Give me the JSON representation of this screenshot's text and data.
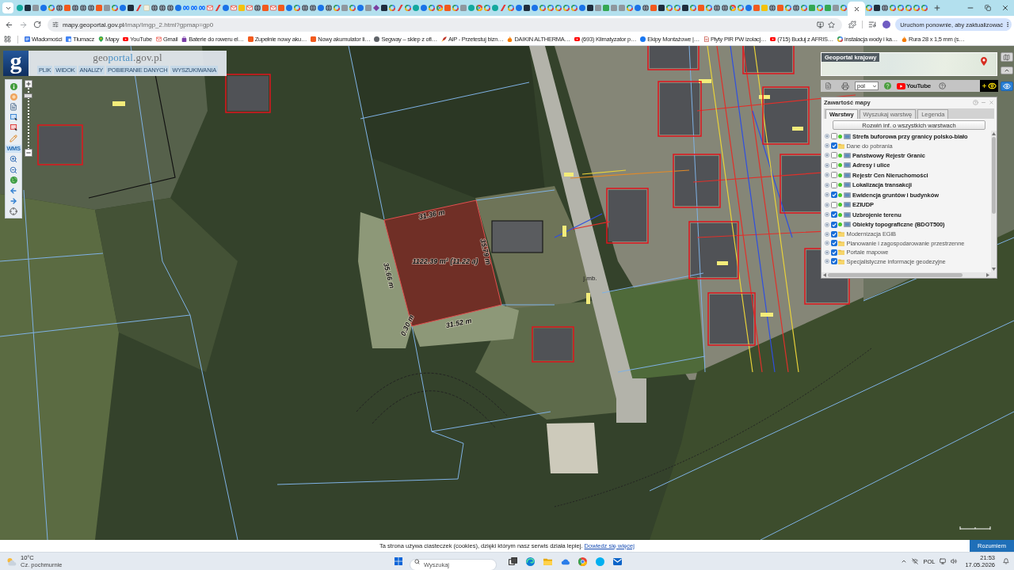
{
  "browser": {
    "tabs": [
      {
        "kind": "teal",
        "selected": false
      },
      {
        "kind": "dark",
        "selected": false
      },
      {
        "kind": "gray",
        "selected": false
      },
      {
        "kind": "blue",
        "selected": false
      },
      {
        "kind": "google",
        "selected": false
      },
      {
        "kind": "globe",
        "selected": false
      },
      {
        "kind": "orange",
        "selected": false
      },
      {
        "kind": "globe",
        "selected": false
      },
      {
        "kind": "globe",
        "selected": false
      },
      {
        "kind": "globe",
        "selected": false
      },
      {
        "kind": "orange",
        "selected": false
      },
      {
        "kind": "gray",
        "selected": false
      },
      {
        "kind": "google",
        "selected": false
      },
      {
        "kind": "blue",
        "selected": false
      },
      {
        "kind": "dark",
        "selected": false
      },
      {
        "kind": "red",
        "selected": false
      },
      {
        "kind": "light",
        "selected": false
      },
      {
        "kind": "globe",
        "selected": false
      },
      {
        "kind": "globe",
        "selected": false
      },
      {
        "kind": "globe",
        "selected": false
      },
      {
        "kind": "blue",
        "selected": false
      },
      {
        "kind": "meta",
        "selected": false
      },
      {
        "kind": "meta",
        "selected": false
      },
      {
        "kind": "meta",
        "selected": false
      },
      {
        "kind": "gmail",
        "selected": false
      },
      {
        "kind": "red",
        "selected": false
      },
      {
        "kind": "blue",
        "selected": false
      },
      {
        "kind": "gmail",
        "selected": false
      },
      {
        "kind": "yellow",
        "selected": false
      },
      {
        "kind": "gmail",
        "selected": false
      },
      {
        "kind": "globe",
        "selected": false
      },
      {
        "kind": "orange",
        "selected": false
      },
      {
        "kind": "gmail",
        "selected": false
      },
      {
        "kind": "orange",
        "selected": false
      },
      {
        "kind": "blue",
        "selected": false
      },
      {
        "kind": "google",
        "selected": false
      },
      {
        "kind": "globe",
        "selected": false
      },
      {
        "kind": "globe",
        "selected": false
      },
      {
        "kind": "blue",
        "selected": false
      },
      {
        "kind": "globe",
        "selected": false
      },
      {
        "kind": "google",
        "selected": false
      },
      {
        "kind": "gray",
        "selected": false
      },
      {
        "kind": "google",
        "selected": false
      },
      {
        "kind": "blue",
        "selected": false
      },
      {
        "kind": "gray",
        "selected": false
      },
      {
        "kind": "purple",
        "selected": false
      },
      {
        "kind": "dark",
        "selected": false
      },
      {
        "kind": "google",
        "selected": false
      },
      {
        "kind": "red",
        "selected": false
      },
      {
        "kind": "google",
        "selected": false
      },
      {
        "kind": "teal",
        "selected": false
      },
      {
        "kind": "blue",
        "selected": false
      },
      {
        "kind": "google",
        "selected": false
      },
      {
        "kind": "multi",
        "selected": false
      },
      {
        "kind": "orange",
        "selected": false
      },
      {
        "kind": "google",
        "selected": false
      },
      {
        "kind": "gray",
        "selected": false
      },
      {
        "kind": "teal",
        "selected": false
      },
      {
        "kind": "multi",
        "selected": false
      },
      {
        "kind": "google",
        "selected": false
      },
      {
        "kind": "teal",
        "selected": false
      },
      {
        "kind": "red",
        "selected": false
      },
      {
        "kind": "google",
        "selected": false
      },
      {
        "kind": "blue",
        "selected": false
      },
      {
        "kind": "dark",
        "selected": false
      },
      {
        "kind": "blue",
        "selected": false
      },
      {
        "kind": "google",
        "selected": false
      },
      {
        "kind": "google",
        "selected": false
      },
      {
        "kind": "google",
        "selected": false
      },
      {
        "kind": "google",
        "selected": false
      },
      {
        "kind": "google",
        "selected": false
      },
      {
        "kind": "blue",
        "selected": false
      },
      {
        "kind": "dark",
        "selected": false
      },
      {
        "kind": "gray",
        "selected": false
      },
      {
        "kind": "green",
        "selected": false
      },
      {
        "kind": "gray",
        "selected": false
      },
      {
        "kind": "gray",
        "selected": false
      },
      {
        "kind": "google",
        "selected": false
      },
      {
        "kind": "blue",
        "selected": false
      },
      {
        "kind": "globe",
        "selected": false
      },
      {
        "kind": "orange",
        "selected": false
      },
      {
        "kind": "dark",
        "selected": false
      },
      {
        "kind": "google",
        "selected": false
      },
      {
        "kind": "google",
        "selected": false
      },
      {
        "kind": "dark",
        "selected": false
      },
      {
        "kind": "google",
        "selected": false
      },
      {
        "kind": "orange",
        "selected": false
      },
      {
        "kind": "google",
        "selected": false
      },
      {
        "kind": "globe",
        "selected": false
      },
      {
        "kind": "globe",
        "selected": false
      },
      {
        "kind": "multi",
        "selected": false
      },
      {
        "kind": "google",
        "selected": false
      },
      {
        "kind": "blue",
        "selected": false
      },
      {
        "kind": "orange",
        "selected": false
      },
      {
        "kind": "yellow",
        "selected": false
      },
      {
        "kind": "globe",
        "selected": false
      },
      {
        "kind": "orange",
        "selected": false
      },
      {
        "kind": "google",
        "selected": false
      },
      {
        "kind": "globe",
        "selected": false
      },
      {
        "kind": "google",
        "selected": false
      },
      {
        "kind": "green",
        "selected": false
      },
      {
        "kind": "google",
        "selected": false
      },
      {
        "kind": "green",
        "selected": false
      },
      {
        "kind": "gray",
        "selected": false
      },
      {
        "kind": "google",
        "selected": false
      },
      {
        "selected": true
      },
      {
        "kind": "google",
        "selected": false
      },
      {
        "kind": "dark",
        "selected": false
      },
      {
        "kind": "globe",
        "selected": false
      },
      {
        "kind": "google",
        "selected": false
      },
      {
        "kind": "google",
        "selected": false
      },
      {
        "kind": "google",
        "selected": false
      },
      {
        "kind": "google",
        "selected": false
      },
      {
        "kind": "google",
        "selected": false
      }
    ],
    "address": {
      "host": "mapy.geoportal.gov.pl",
      "path": "/imap/Imgp_2.html?gpmap=gp0"
    },
    "update_button": "Uruchom ponownie, aby zaktualizować",
    "bookmarks": [
      {
        "kind": "news",
        "label": "Wiadomości"
      },
      {
        "kind": "translate",
        "label": "Tłumacz"
      },
      {
        "kind": "maps",
        "label": "Mapy"
      },
      {
        "kind": "youtube",
        "label": "YouTube"
      },
      {
        "kind": "gmail",
        "label": "Gmail"
      },
      {
        "kind": "shop",
        "label": "Baterie do roweru el…"
      },
      {
        "kind": "orange",
        "label": "Zupełnie nowy aku…"
      },
      {
        "kind": "orange",
        "label": "Nowy akumulator li…"
      },
      {
        "kind": "letter",
        "label": "Segway – sklep z ofi…"
      },
      {
        "kind": "rocket",
        "label": "AiP - Przetestuj bizn…"
      },
      {
        "kind": "flame",
        "label": "DAIKIN ALTHERMA…"
      },
      {
        "kind": "youtube",
        "label": "(693) Klimatyzator p…"
      },
      {
        "kind": "facebook",
        "label": "Ekipy Montażowe |…"
      },
      {
        "kind": "page",
        "label": "Płyty PIR PW izolacj…"
      },
      {
        "kind": "youtube",
        "label": "(715) Buduj z AFRIS…"
      },
      {
        "kind": "google",
        "label": "instalacja wody i ka…"
      },
      {
        "kind": "flame",
        "label": "Rura 28 x 1,5 mm (s…"
      }
    ]
  },
  "geoportal": {
    "logo": {
      "mark": "g",
      "title": [
        {
          "text": "geo",
          "kind": "plain"
        },
        {
          "text": "portal",
          "kind": "accent"
        },
        {
          "text": ".gov.pl",
          "kind": "plain"
        }
      ]
    },
    "menu": [
      "PLIK",
      "WIDOK",
      "ANALIZY",
      "POBIERANIE DANYCH",
      "WYSZUKIWANIA"
    ],
    "tools": [
      {
        "kind": "info"
      },
      {
        "kind": "home"
      },
      {
        "kind": "page"
      },
      {
        "kind": "select"
      },
      {
        "kind": "select_red"
      },
      {
        "kind": "pencil"
      },
      {
        "kind": "wms",
        "label": "WMS"
      },
      {
        "kind": "zoom_in"
      },
      {
        "kind": "zoom_out"
      },
      {
        "kind": "globe"
      },
      {
        "kind": "back"
      },
      {
        "kind": "forward"
      },
      {
        "kind": "target"
      }
    ],
    "zoom": {
      "level": 0.9
    },
    "overview": {
      "title": "Geoportal krajowy"
    },
    "toolbar": {
      "language": "pol",
      "video_logo": "YouTube"
    },
    "contents": {
      "title": "Zawartość mapy",
      "tabs": [
        {
          "label": "Warstwy",
          "selected": true
        },
        {
          "label": "Wyszukaj warstwę",
          "selected": false
        },
        {
          "label": "Legenda",
          "selected": false
        }
      ],
      "expand_all": "Rozwiń inf. o wszystkich warstwach",
      "layers": [
        {
          "kind": "service",
          "name": "Strefa buforowa przy granicy polsko-biało",
          "checked": false
        },
        {
          "kind": "group",
          "name": "Dane do pobrania",
          "checked": true
        },
        {
          "kind": "service",
          "name": "Państwowy Rejestr Granic",
          "checked": false
        },
        {
          "kind": "service",
          "name": "Adresy i ulice",
          "checked": false
        },
        {
          "kind": "service",
          "name": "Rejestr Cen Nieruchomości",
          "checked": false
        },
        {
          "kind": "service",
          "name": "Lokalizacja transakcji",
          "checked": false
        },
        {
          "kind": "service",
          "name": "Ewidencja gruntów i budynków",
          "checked": true
        },
        {
          "kind": "service",
          "name": "EZIUDP",
          "checked": false
        },
        {
          "kind": "service",
          "name": "Uzbrojenie terenu",
          "checked": true
        },
        {
          "kind": "service",
          "name": "Obiekty topograficzne (BDOT500)",
          "checked": true
        },
        {
          "kind": "group",
          "name": "Modernizacja EGiB",
          "checked": true
        },
        {
          "kind": "group",
          "name": "Planowanie i zagospodarowanie przestrzenne",
          "checked": true
        },
        {
          "kind": "group",
          "name": "Portale mapowe",
          "checked": true
        },
        {
          "kind": "group",
          "name": "Specjalistyczne informacje geodezyjne",
          "checked": true
        }
      ]
    }
  },
  "map": {
    "labels": [
      "j.mb."
    ],
    "measurement": {
      "area": "1122.39 m² (11.22 a)",
      "edges": [
        "31.36 m",
        "35.79 m",
        "35.66 m",
        "31.52 m",
        "0.30 m"
      ]
    }
  },
  "cookie_bar": {
    "message": "Ta strona używa ciasteczek (cookies), dzięki którym nasz serwis działa lepiej.",
    "link": "Dowiedz się więcej",
    "button": "Rozumiem"
  },
  "taskbar": {
    "weather": {
      "temperature": "10°C",
      "condition": "Cz. pochmurnie"
    },
    "search": {
      "placeholder": "Wyszukaj"
    },
    "apps": [
      {
        "kind": "taskview"
      },
      {
        "kind": "edge"
      },
      {
        "kind": "explorer"
      },
      {
        "kind": "cloud"
      },
      {
        "kind": "chrome"
      },
      {
        "kind": "skype"
      },
      {
        "kind": "outlook"
      }
    ],
    "tray": {
      "language": "POL",
      "time": "21:53",
      "date": "17.05.2026"
    }
  }
}
